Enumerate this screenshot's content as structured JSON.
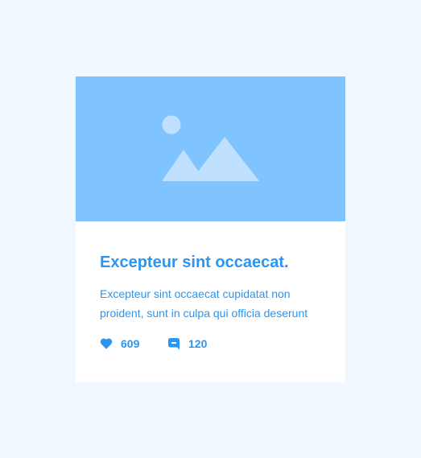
{
  "colors": {
    "page_background": "#f0f7ff",
    "card_background": "#ffffff",
    "media_background": "#80c4ff",
    "media_glyph": "#bfe1ff",
    "accent": "#2b95f0"
  },
  "card": {
    "media": {
      "icon": "image-placeholder-icon"
    },
    "title": "Excepteur sint occaecat.",
    "text_lines": [
      "Excepteur sint occaecat cupidatat non",
      "proident, sunt in culpa qui officia deserunt"
    ],
    "stats": {
      "likes": {
        "icon": "heart-icon",
        "count": "609"
      },
      "comments": {
        "icon": "comment-icon",
        "count": "120"
      }
    }
  }
}
